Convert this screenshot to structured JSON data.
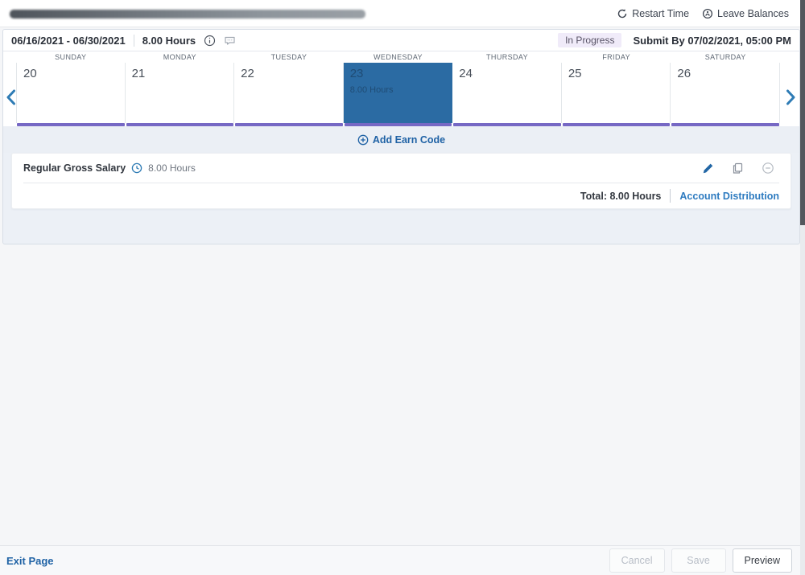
{
  "header": {
    "restart_time_label": "Restart Time",
    "leave_balances_label": "Leave Balances"
  },
  "period_bar": {
    "date_range": "06/16/2021 - 06/30/2021",
    "total_hours": "8.00 Hours",
    "status_badge": "In Progress",
    "submit_by": "Submit By 07/02/2021, 05:00 PM"
  },
  "calendar": {
    "day_headers": [
      "SUNDAY",
      "MONDAY",
      "TUESDAY",
      "WEDNESDAY",
      "THURSDAY",
      "FRIDAY",
      "SATURDAY"
    ],
    "days": [
      {
        "date": "20",
        "hours": "",
        "selected": false
      },
      {
        "date": "21",
        "hours": "",
        "selected": false
      },
      {
        "date": "22",
        "hours": "",
        "selected": false
      },
      {
        "date": "23",
        "hours": "8.00 Hours",
        "selected": true
      },
      {
        "date": "24",
        "hours": "",
        "selected": false
      },
      {
        "date": "25",
        "hours": "",
        "selected": false
      },
      {
        "date": "26",
        "hours": "",
        "selected": false
      }
    ]
  },
  "earn_code_section": {
    "add_label": "Add Earn Code",
    "entries": [
      {
        "name": "Regular Gross Salary",
        "hours": "8.00 Hours"
      }
    ],
    "total_label": "Total: 8.00 Hours",
    "account_distribution_label": "Account Distribution"
  },
  "footer": {
    "exit_label": "Exit Page",
    "cancel_label": "Cancel",
    "save_label": "Save",
    "preview_label": "Preview"
  },
  "colors": {
    "accent_blue": "#1f62a5",
    "link_blue": "#2e7bc0",
    "selected_day_bg": "#2b6ba3",
    "selected_day_text": "#1f4c75",
    "purple_underline": "#7668c4",
    "badge_bg": "#f0ebf9",
    "badge_text": "#575265"
  }
}
